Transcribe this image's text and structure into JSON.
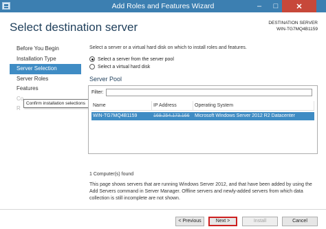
{
  "window": {
    "title": "Add Roles and Features Wizard",
    "controls": {
      "minimize": "–",
      "maximize": "□",
      "close": "✕"
    }
  },
  "header": {
    "page_title": "Select destination server",
    "dest_label": "DESTINATION SERVER",
    "dest_value": "WIN-TG7MQ4B1159"
  },
  "nav": {
    "items": [
      {
        "label": "Before You Begin"
      },
      {
        "label": "Installation Type"
      },
      {
        "label": "Server Selection"
      },
      {
        "label": "Server Roles"
      },
      {
        "label": "Features"
      },
      {
        "label": "Co"
      },
      {
        "label": "R"
      }
    ]
  },
  "tooltip": {
    "text": "Confirm installation selections"
  },
  "content": {
    "intro": "Select a server or a virtual hard disk on which to install roles and features.",
    "options": [
      {
        "label": "Select a server from the server pool",
        "checked": true
      },
      {
        "label": "Select a virtual hard disk",
        "checked": false
      }
    ],
    "pool_title": "Server Pool",
    "filter_label": "Filter:",
    "filter_value": "",
    "columns": [
      "Name",
      "IP Address",
      "Operating System"
    ],
    "rows": [
      {
        "name": "WIN-TG7MQ4B1159",
        "ip": "169.254.173.166",
        "os": "Microsoft Windows Server 2012 R2 Datacenter"
      }
    ],
    "count": "1 Computer(s) found",
    "description": "This page shows servers that are running Windows Server 2012, and that have been added by using the Add Servers command in Server Manager. Offline servers and newly-added servers from which data collection is still incomplete are not shown."
  },
  "footer": {
    "previous": "< Previous",
    "next": "Next >",
    "install": "Install",
    "cancel": "Cancel"
  },
  "colors": {
    "titlebar": "#3c7fb1",
    "selection": "#3f8cc4",
    "highlight_box": "#cc1f1f"
  }
}
